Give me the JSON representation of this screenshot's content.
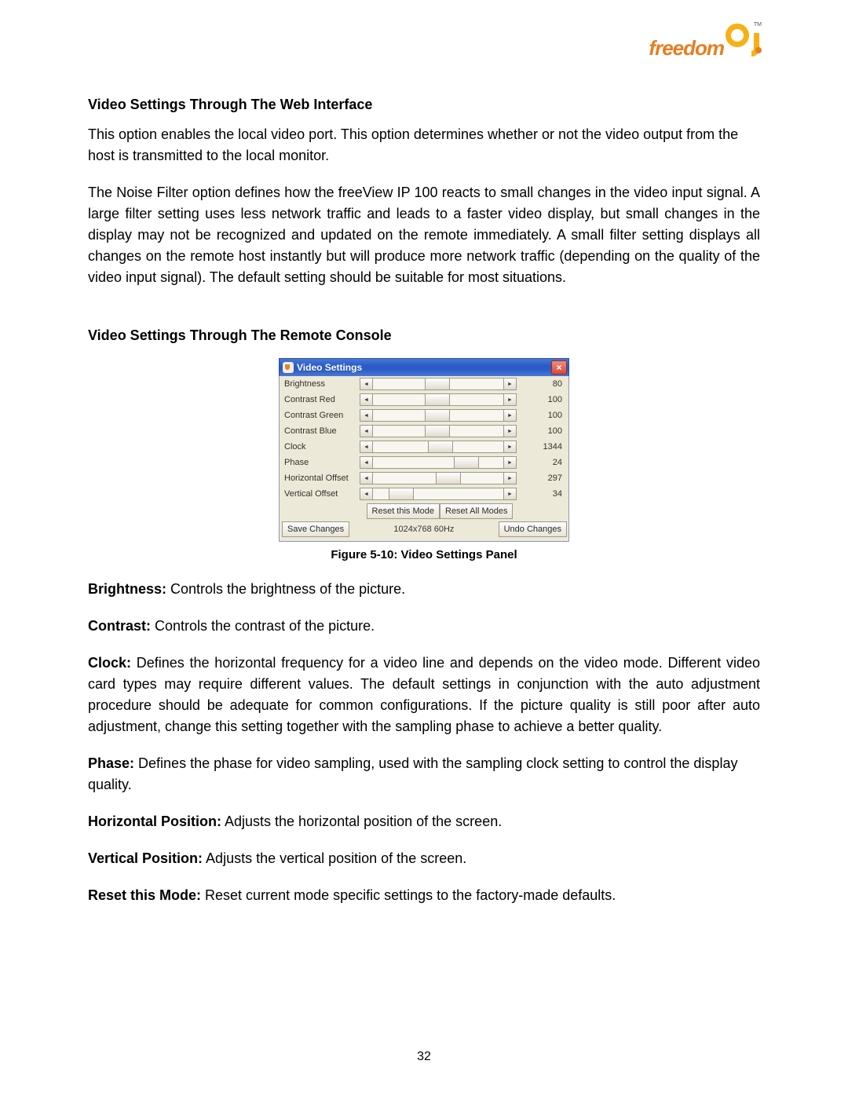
{
  "logo": {
    "brand": "freedom",
    "trademark": "TM"
  },
  "sections": {
    "heading_web": "Video Settings Through The Web Interface",
    "para_web_1": "This option enables the local video port. This option determines whether or not the video output from the host is transmitted to the local monitor.",
    "para_web_2": "The Noise Filter option defines how the freeView IP 100 reacts to small changes in the video input signal. A large filter setting uses less network traffic and leads to a faster video display, but small changes in the display may not be recognized and updated on the remote immediately. A small filter setting displays all changes on the remote host instantly but will produce more network traffic (depending on the quality of the video input signal). The default setting should be suitable for most situations.",
    "heading_remote": "Video Settings Through The Remote Console"
  },
  "panel": {
    "title": "Video Settings",
    "close": "×",
    "rows": [
      {
        "label": "Brightness",
        "value": "80",
        "thumb_pct": 40
      },
      {
        "label": "Contrast Red",
        "value": "100",
        "thumb_pct": 40
      },
      {
        "label": "Contrast Green",
        "value": "100",
        "thumb_pct": 40
      },
      {
        "label": "Contrast Blue",
        "value": "100",
        "thumb_pct": 40
      },
      {
        "label": "Clock",
        "value": "1344",
        "thumb_pct": 42
      },
      {
        "label": "Phase",
        "value": "24",
        "thumb_pct": 62
      },
      {
        "label": "Horizontal Offset",
        "value": "297",
        "thumb_pct": 48
      },
      {
        "label": "Vertical Offset",
        "value": "34",
        "thumb_pct": 12
      }
    ],
    "reset_this": "Reset this Mode",
    "reset_all": "Reset All Modes",
    "save": "Save Changes",
    "undo": "Undo Changes",
    "mode": "1024x768 60Hz",
    "arrow_left": "◄",
    "arrow_right": "►"
  },
  "caption": "Figure 5-10: Video Settings Panel",
  "defs": {
    "brightness": {
      "term": "Brightness:",
      "text": " Controls the brightness of the picture."
    },
    "contrast": {
      "term": "Contrast:",
      "text": " Controls the contrast of the picture."
    },
    "clock": {
      "term": "Clock:",
      "text": " Defines the horizontal frequency for a video line and depends on the video mode. Different video card types may require different values. The default settings in conjunction with the auto adjustment procedure should be adequate for common configurations. If the picture quality is still poor after auto adjustment, change this setting together with the sampling phase to achieve a better quality."
    },
    "phase": {
      "term": "Phase:",
      "text": " Defines the phase for video sampling, used with the sampling clock setting to control the display quality."
    },
    "hpos": {
      "term": "Horizontal Position:",
      "text": " Adjusts the horizontal position of the screen."
    },
    "vpos": {
      "term": "Vertical Position:",
      "text": " Adjusts the vertical position of the screen."
    },
    "reset": {
      "term": "Reset this Mode:",
      "text": " Reset current mode specific settings to the factory-made defaults."
    }
  },
  "page_number": "32"
}
